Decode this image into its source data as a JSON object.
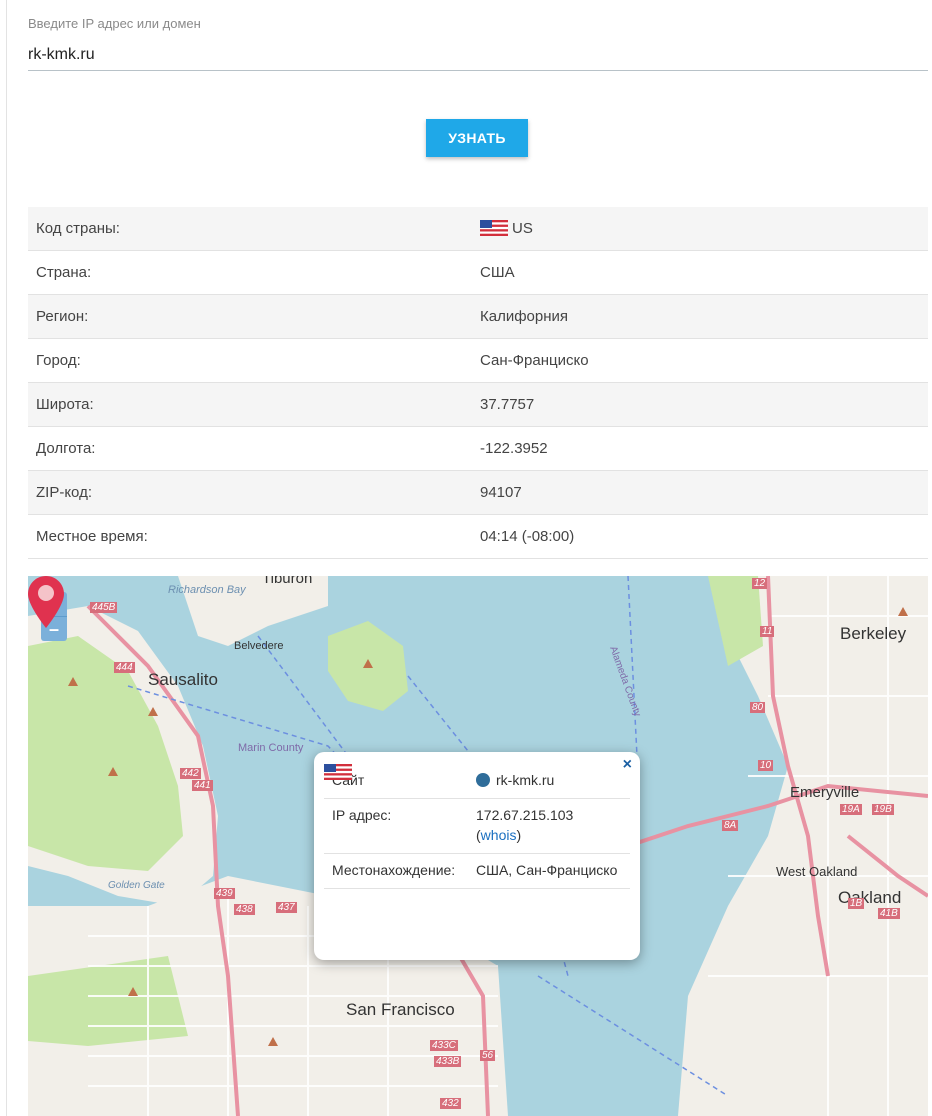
{
  "form": {
    "label": "Введите IP адрес или домен",
    "value": "rk-kmk.ru",
    "button": "УЗНАТЬ"
  },
  "info": {
    "rows": [
      {
        "key": "Код страны:",
        "value": "US",
        "flag": "us-flag-icon"
      },
      {
        "key": "Страна:",
        "value": "США"
      },
      {
        "key": "Регион:",
        "value": "Калифорния"
      },
      {
        "key": "Город:",
        "value": "Сан-Франциско"
      },
      {
        "key": "Широта:",
        "value": "37.7757"
      },
      {
        "key": "Долгота:",
        "value": "-122.3952"
      },
      {
        "key": "ZIP-код:",
        "value": "94107"
      },
      {
        "key": "Местное время:",
        "value": "04:14 (-08:00)"
      }
    ]
  },
  "map": {
    "zoom_in": "+",
    "zoom_out": "–",
    "labels": {
      "sausalito": "Sausalito",
      "belvedere": "Belvedere",
      "berkeley": "Berkeley",
      "emeryville": "Emeryville",
      "west_oakland": "West Oakland",
      "oakland": "Oakland",
      "san_francisco": "San Francisco",
      "golden_gate": "Golden Gate",
      "richardson_bay": "Richardson Bay",
      "marin_county": "Marin County",
      "alameda_county": "Alameda County",
      "tiburon": "Tiburon"
    },
    "shields": [
      "445B",
      "444",
      "442",
      "441",
      "439",
      "438",
      "437",
      "433C",
      "433B",
      "432",
      "56",
      "80",
      "19A",
      "19B",
      "8A",
      "1B",
      "41B",
      "12",
      "11",
      "10"
    ],
    "popup": {
      "close": "×",
      "site_label": "Сайт",
      "site_value": "rk-kmk.ru",
      "ip_label": "IP адрес:",
      "ip_value": "172.67.215.103",
      "whois_prefix": "(",
      "whois_link": "whois",
      "whois_suffix": ")",
      "location_label": "Местонахождение:",
      "location_value": "США, Сан-Франциско"
    },
    "colors": {
      "water": "#aad3df",
      "land": "#f2efe9",
      "park": "#c8e6a8",
      "motorway": "#e892a2",
      "pin": "#e0324f"
    }
  }
}
